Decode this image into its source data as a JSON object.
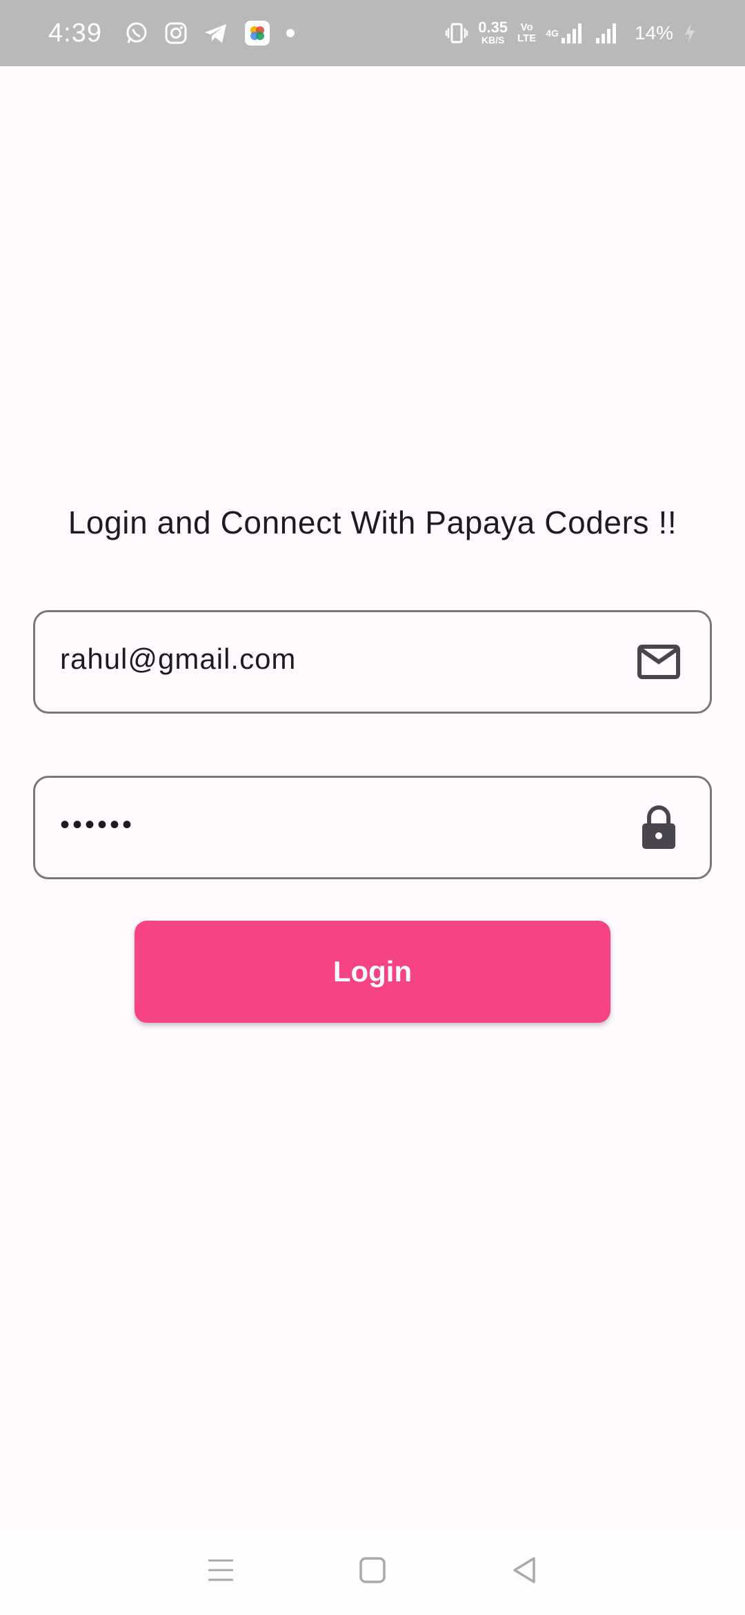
{
  "status_bar": {
    "time": "4:39",
    "net_speed_value": "0.35",
    "net_speed_unit": "KB/S",
    "volte_top": "Vo",
    "volte_bottom": "LTE",
    "network_type": "4G",
    "battery_percent": "14%",
    "notification_icons": [
      "whatsapp-icon",
      "instagram-icon",
      "telegram-icon",
      "photos-icon",
      "dot-icon"
    ],
    "system_icons": [
      "vibrate-icon",
      "signal-icon",
      "signal-icon-2",
      "charging-icon"
    ]
  },
  "login": {
    "title": "Login and Connect With Papaya Coders !!",
    "email_value": "rahul@gmail.com",
    "email_icon": "mail-icon",
    "password_value": "••••••",
    "password_icon": "lock-icon",
    "login_label": "Login"
  },
  "colors": {
    "accent": "#f64386",
    "background": "#fffafd",
    "status_bar": "#b9b8bb",
    "field_border": "#7a7579",
    "icon": "#49454f"
  },
  "nav_bar": {
    "buttons": [
      "menu-icon",
      "home-icon",
      "back-icon"
    ]
  }
}
